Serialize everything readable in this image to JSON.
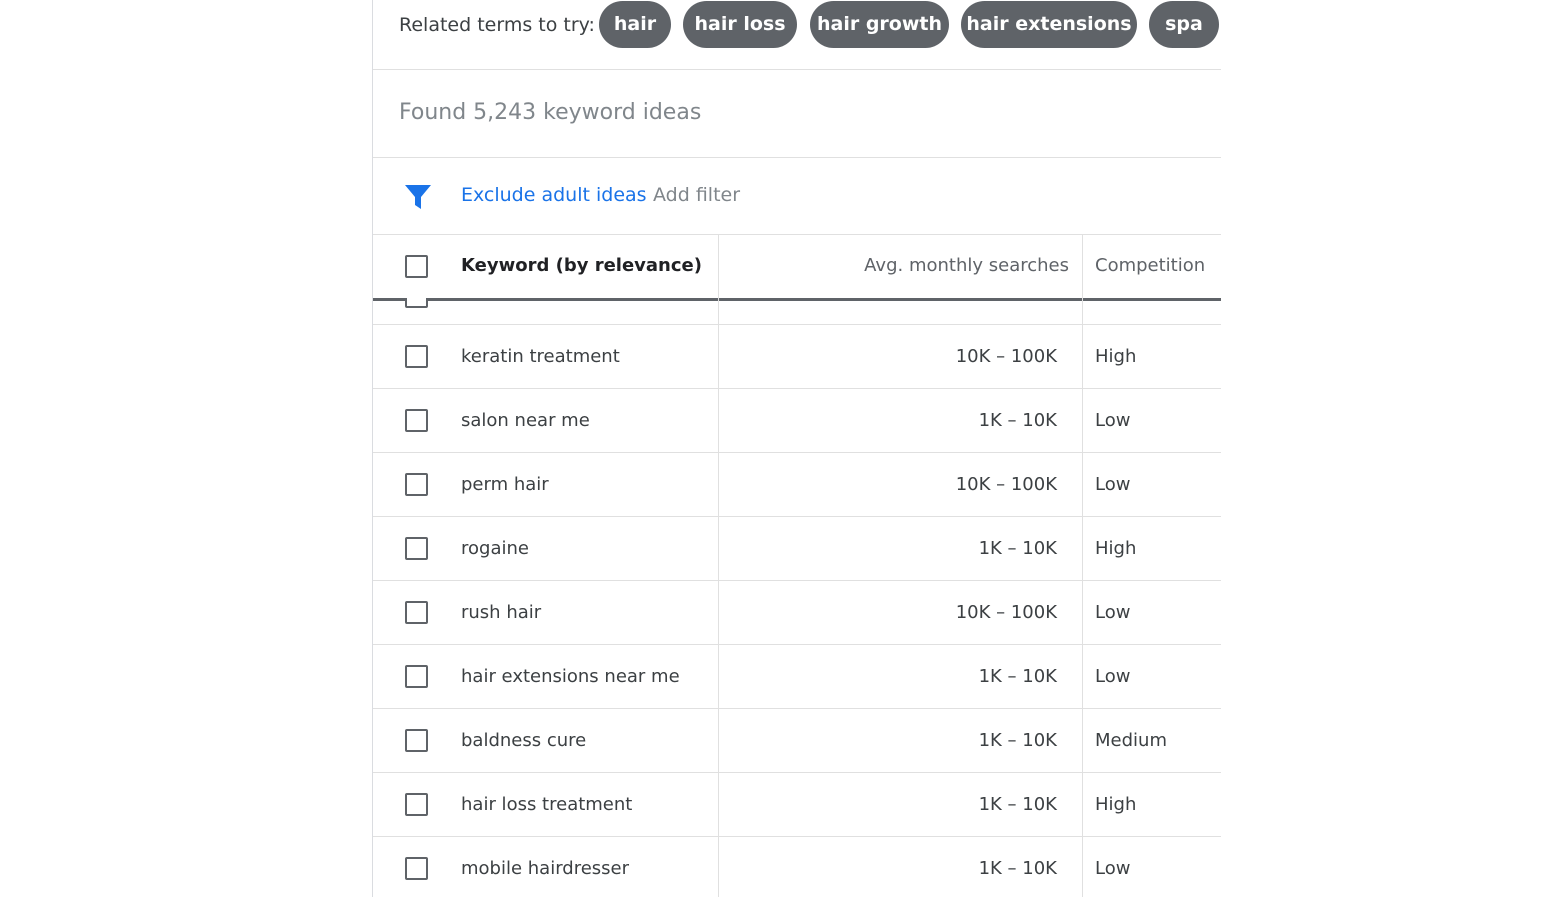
{
  "related": {
    "label": "Related terms to try:",
    "chips": [
      "hair",
      "hair loss",
      "hair growth",
      "hair extensions",
      "spa"
    ]
  },
  "found": {
    "text": "Found 5,243 keyword ideas"
  },
  "filters": {
    "icon": "filter-icon",
    "active_filter": "Exclude adult ideas",
    "add_filter": "Add filter",
    "accent_color": "#1a73e8"
  },
  "table": {
    "headers": {
      "keyword": "Keyword (by relevance)",
      "avg_searches": "Avg. monthly searches",
      "competition": "Competition"
    },
    "rows": [
      {
        "keyword": "keratin treatment",
        "avg": "10K – 100K",
        "competition": "High"
      },
      {
        "keyword": "salon near me",
        "avg": "1K – 10K",
        "competition": "Low"
      },
      {
        "keyword": "perm hair",
        "avg": "10K – 100K",
        "competition": "Low"
      },
      {
        "keyword": "rogaine",
        "avg": "1K – 10K",
        "competition": "High"
      },
      {
        "keyword": "rush hair",
        "avg": "10K – 100K",
        "competition": "Low"
      },
      {
        "keyword": "hair extensions near me",
        "avg": "1K – 10K",
        "competition": "Low"
      },
      {
        "keyword": "baldness cure",
        "avg": "1K – 10K",
        "competition": "Medium"
      },
      {
        "keyword": "hair loss treatment",
        "avg": "1K – 10K",
        "competition": "High"
      },
      {
        "keyword": "mobile hairdresser",
        "avg": "1K – 10K",
        "competition": "Low"
      }
    ]
  }
}
